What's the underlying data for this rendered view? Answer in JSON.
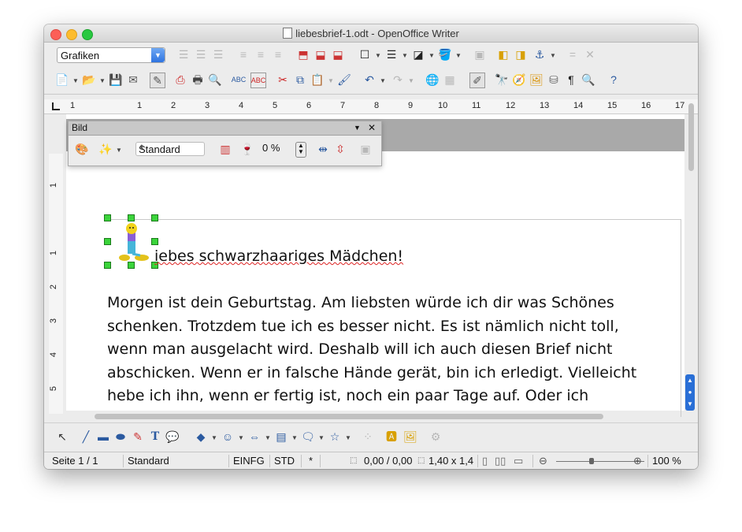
{
  "window": {
    "title": "liebesbrief-1.odt - OpenOffice Writer"
  },
  "toolbar": {
    "paragraph_style": "Grafiken"
  },
  "ruler": {
    "numbers": [
      "1",
      "1",
      "2",
      "3",
      "4",
      "5",
      "6",
      "7",
      "8",
      "9",
      "10",
      "11",
      "12",
      "13",
      "14",
      "15",
      "16",
      "17"
    ],
    "vertical_numbers": [
      "1",
      "1",
      "2",
      "3",
      "4",
      "5"
    ]
  },
  "image_toolbar": {
    "title": "Bild",
    "mode_select": "Standard",
    "transparency": "0 %"
  },
  "document": {
    "salutation": "iebes schwarzhaariges Mädchen!",
    "lines": [
      "Morgen ist dein Geburtstag. Am liebsten würde ich dir was Schönes",
      "schenken. Trotzdem tue ich es besser nicht. Es ist nämlich nicht toll,",
      "wenn man ausgelacht wird. Deshalb will ich auch diesen Brief nicht",
      "abschicken. Wenn er in falsche Hände gerät, bin ich erledigt. Vielleicht",
      "hebe ich ihn, wenn er fertig ist, noch ein paar Tage auf. Oder ich"
    ]
  },
  "statusbar": {
    "page": "Seite 1 / 1",
    "style": "Standard",
    "insert_mode": "EINFG",
    "selection_mode": "STD",
    "modified": "*",
    "position": "0,00 / 0,00",
    "size": "1,40 x 1,4",
    "zoom": "100 %"
  },
  "colors": {
    "accent": "#2f74e0",
    "handle": "#3bd43b",
    "gray_band": "#a9a9a9"
  }
}
